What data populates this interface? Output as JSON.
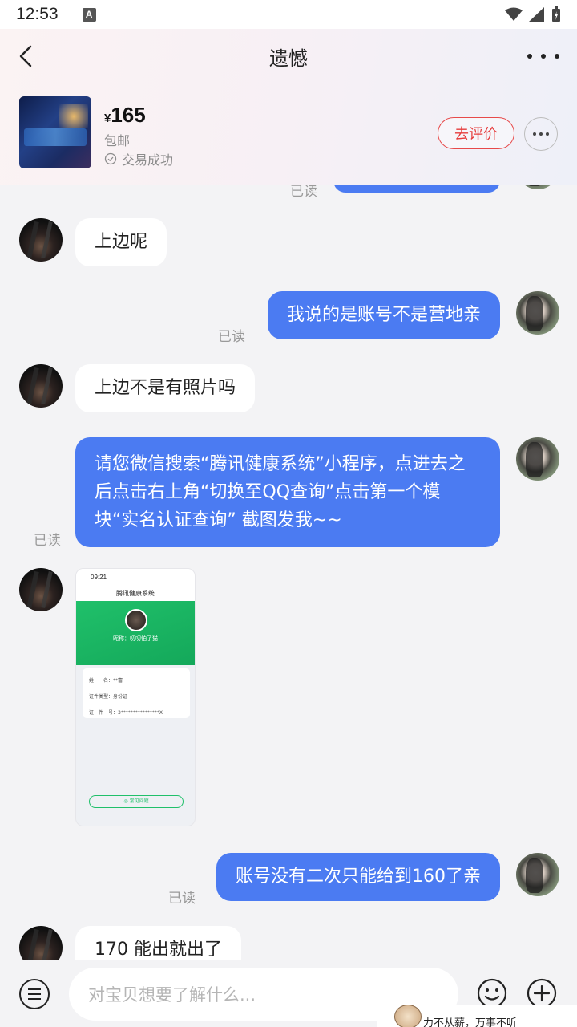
{
  "status_bar": {
    "time": "12:53",
    "notification_icon": "A"
  },
  "nav": {
    "title": "遗憾"
  },
  "item": {
    "currency": "¥",
    "price": "165",
    "shipping": "包邮",
    "deal_status": "交易成功",
    "review_button": "去评价"
  },
  "messages": [
    {
      "from": "other",
      "text": "上边呢"
    },
    {
      "from": "me",
      "text": "我说的是账号不是营地亲",
      "read": "已读"
    },
    {
      "from": "other",
      "text": "上边不是有照片吗"
    },
    {
      "from": "me",
      "text": "请您微信搜索“腾讯健康系统”小程序，点进去之后点击右上角“切换至QQ查询”点击第一个模块“实名认证查询” 截图发我~~",
      "read": "已读"
    },
    {
      "from": "other",
      "type": "image",
      "image_texts": {
        "time": "09:21",
        "title": "腾讯健康系统",
        "name": "昵称：叨叨怕了猫",
        "field1": "姓　　名：",
        "field1_val": "**富",
        "field2": "证件类型：",
        "field2_val": "身份证",
        "field3": "证　件　号：",
        "field3_val": "3****************X",
        "button": "◎ 常见问题"
      }
    },
    {
      "from": "me",
      "text": "账号没有二次只能给到160了亲",
      "read": "已读"
    },
    {
      "from": "other",
      "text": "170 能出就出了"
    }
  ],
  "top_stub_read": "已读",
  "input": {
    "placeholder": "对宝贝想要了解什么..."
  },
  "sticker_text": "力不从薪，万事不听",
  "colors": {
    "accent_blue": "#4b7bf2",
    "review_red": "#e63c3c"
  }
}
